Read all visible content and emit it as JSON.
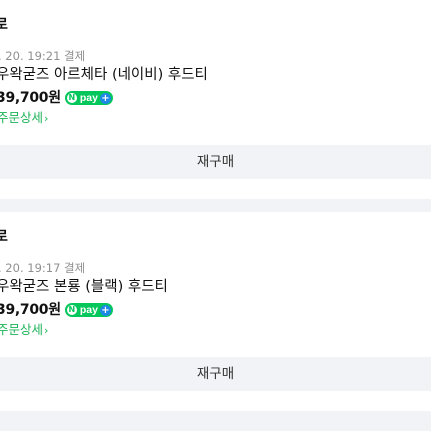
{
  "orders": [
    {
      "status": "로",
      "date": ". 20. 19:21 결제",
      "product": "우왁굳즈 아르체타 (네이비) 후드티",
      "price": "39,700원",
      "npay_label": "pay",
      "detail_label": "주문상세",
      "rebuy_label": "재구매"
    },
    {
      "status": "로",
      "date": ". 20. 19:17 결제",
      "product": "우왁굳즈 본룡 (블랙) 후드티",
      "price": "39,700원",
      "npay_label": "pay",
      "detail_label": "주문상세",
      "rebuy_label": "재구매"
    }
  ],
  "colors": {
    "npay_green": "#03c75a",
    "npay_plus_blue": "#1e88e5",
    "link_green": "#1fb45a",
    "separator": "#f2f3f6"
  },
  "icons": {
    "npay_badge": "naver-pay-plus-icon",
    "detail_chevron": "chevron-right-icon"
  }
}
